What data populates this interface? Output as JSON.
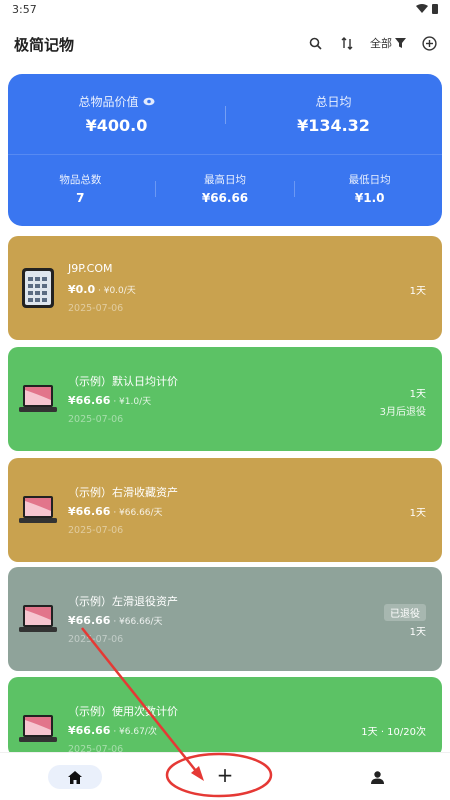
{
  "status_bar": {
    "time": "3:57"
  },
  "app_bar": {
    "title": "极简记物",
    "filter_label": "全部",
    "icons": [
      "search-icon",
      "sort-icon",
      "filter-icon",
      "add-circle-icon"
    ]
  },
  "summary": {
    "total_value_label": "总物品价值",
    "total_value": "¥400.0",
    "daily_avg_label": "总日均",
    "daily_avg": "¥134.32",
    "item_count_label": "物品总数",
    "item_count": "7",
    "max_daily_label": "最高日均",
    "max_daily": "¥66.66",
    "min_daily_label": "最低日均",
    "min_daily": "¥1.0",
    "color": "#3a76f0"
  },
  "items": [
    {
      "name": "J9P.COM",
      "price": "¥0.0",
      "rate": " · ¥0.0/天",
      "date": "2025-07-06",
      "right": "1天",
      "right2": "",
      "badge": "",
      "color": "#c9a24f",
      "icon": "phone-icon"
    },
    {
      "name": "（示例）默认日均计价",
      "price": "¥66.66",
      "rate": " · ¥1.0/天",
      "date": "2025-07-06",
      "right": "1天",
      "right2": "3月后退役",
      "badge": "",
      "color": "#5cc265",
      "icon": "laptop-icon"
    },
    {
      "name": "（示例）右滑收藏资产",
      "price": "¥66.66",
      "rate": " · ¥66.66/天",
      "date": "2025-07-06",
      "right": "1天",
      "right2": "",
      "badge": "",
      "color": "#c9a24f",
      "icon": "laptop-icon"
    },
    {
      "name": "（示例）左滑退役资产",
      "price": "¥66.66",
      "rate": " · ¥66.66/天",
      "date": "2025-07-06",
      "right": "1天",
      "right2": "",
      "badge": "已退役",
      "color": "#8fa39a",
      "icon": "laptop-icon"
    },
    {
      "name": "（示例）使用次数计价",
      "price": "¥66.66",
      "rate": " · ¥6.67/次",
      "date": "2025-07-06",
      "right": "1天 · 10/20次",
      "right2": "",
      "badge": "",
      "color": "#5cc265",
      "icon": "laptop-icon"
    }
  ],
  "bottom_nav": {
    "add_label": "+",
    "icons": [
      "home-icon",
      "add-icon",
      "profile-icon"
    ]
  },
  "annotation_color": "#e53935"
}
